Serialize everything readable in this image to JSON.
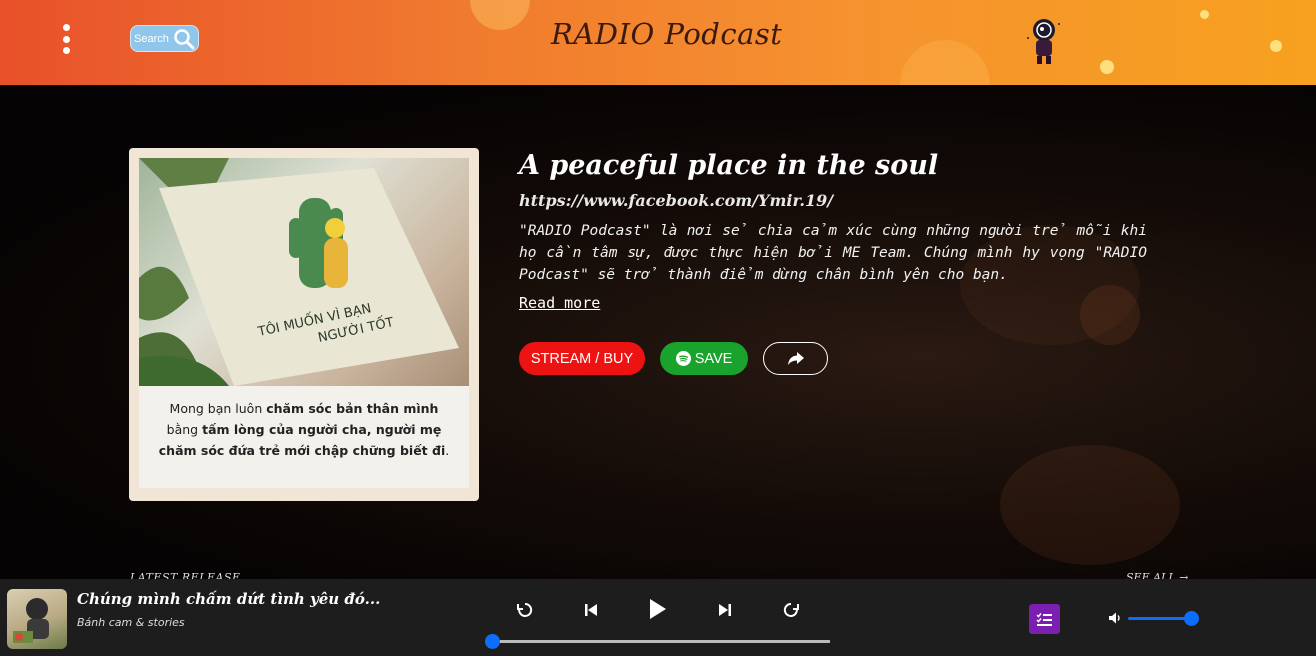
{
  "header": {
    "search_label": "Search",
    "site_title": "RADIO Podcast"
  },
  "featured": {
    "cover_caption_parts": [
      "Mong bạn luôn ",
      "chăm sóc bản thân mình",
      " bằng ",
      "tấm lòng của người cha, người mẹ chăm sóc đứa trẻ mới chập chững biết đi",
      "."
    ],
    "book_title_line1": "TÔI MUỐN VÌ BẠN",
    "book_title_line2": "NGƯỜI TỐT",
    "title": "A peaceful place in the soul",
    "link": "https://www.facebook.com/Ymir.19/",
    "description": "\"RADIO Podcast\" là nơi sẻ chia cảm xúc cùng những người trẻ mỗi khi họ cần tâm sự, được thực hiện bởi ME Team. Chúng mình hy vọng \"RADIO Podcast\" sẽ trở thành điểm dừng chân bình yên cho bạn.",
    "read_more": "Read more",
    "stream_label": "STREAM / BUY",
    "save_label": "SAVE"
  },
  "sections": {
    "latest_release": "LATEST RELEASE",
    "see_all": "SEE ALL"
  },
  "player": {
    "track_title": "Chúng mình chấm dứt tình yêu đó...",
    "artist": "Bánh cam & stories",
    "progress": 0.0,
    "volume": 1.0
  },
  "colors": {
    "stream": "#ee1313",
    "save": "#19a22c",
    "accent": "#0d6efd",
    "queue": "#7a1fb0"
  }
}
